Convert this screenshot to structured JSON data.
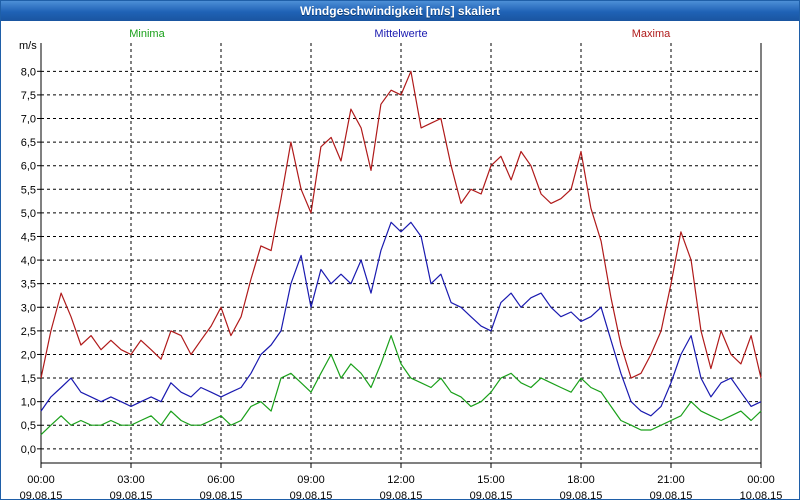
{
  "window": {
    "title": "Windgeschwindigkeit [m/s] skaliert"
  },
  "legend": [
    {
      "label": "Minima",
      "color": "#1aa01a"
    },
    {
      "label": "Mittelwerte",
      "color": "#1a1ab0"
    },
    {
      "label": "Maxima",
      "color": "#b01a1a"
    }
  ],
  "chart_data": {
    "type": "line",
    "ylabel": "m/s",
    "xlabel": "",
    "ylim": [
      -0.3,
      8.6
    ],
    "yticks": [
      "0,0",
      "0,5",
      "1,0",
      "1,5",
      "2,0",
      "2,5",
      "3,0",
      "3,5",
      "4,0",
      "4,5",
      "5,0",
      "5,5",
      "6,0",
      "6,5",
      "7,0",
      "7,5",
      "8,0"
    ],
    "xticks": [
      {
        "time": "00:00",
        "date": "09.08.15"
      },
      {
        "time": "03:00",
        "date": "09.08.15"
      },
      {
        "time": "06:00",
        "date": "09.08.15"
      },
      {
        "time": "09:00",
        "date": "09.08.15"
      },
      {
        "time": "12:00",
        "date": "09.08.15"
      },
      {
        "time": "15:00",
        "date": "09.08.15"
      },
      {
        "time": "18:00",
        "date": "09.08.15"
      },
      {
        "time": "21:00",
        "date": "09.08.15"
      },
      {
        "time": "00:00",
        "date": "10.08.15"
      }
    ],
    "grid": true,
    "x_hours": [
      0,
      0.33,
      0.67,
      1,
      1.33,
      1.67,
      2,
      2.33,
      2.67,
      3,
      3.33,
      3.67,
      4,
      4.33,
      4.67,
      5,
      5.33,
      5.67,
      6,
      6.33,
      6.67,
      7,
      7.33,
      7.67,
      8,
      8.33,
      8.67,
      9,
      9.33,
      9.67,
      10,
      10.33,
      10.67,
      11,
      11.33,
      11.67,
      12,
      12.33,
      12.67,
      13,
      13.33,
      13.67,
      14,
      14.33,
      14.67,
      15,
      15.33,
      15.67,
      16,
      16.33,
      16.67,
      17,
      17.33,
      17.67,
      18,
      18.33,
      18.67,
      19,
      19.33,
      19.67,
      20,
      20.33,
      20.67,
      21,
      21.33,
      21.67,
      22,
      22.33,
      22.67,
      23,
      23.33,
      23.67,
      24
    ],
    "series": [
      {
        "name": "Minima",
        "color": "#1aa01a",
        "values": [
          0.3,
          0.5,
          0.7,
          0.5,
          0.6,
          0.5,
          0.5,
          0.6,
          0.5,
          0.5,
          0.6,
          0.7,
          0.5,
          0.8,
          0.6,
          0.5,
          0.5,
          0.6,
          0.7,
          0.5,
          0.6,
          0.9,
          1.0,
          0.8,
          1.5,
          1.6,
          1.4,
          1.2,
          1.6,
          2.0,
          1.5,
          1.8,
          1.6,
          1.3,
          1.8,
          2.4,
          1.8,
          1.5,
          1.4,
          1.3,
          1.5,
          1.2,
          1.1,
          0.9,
          1.0,
          1.2,
          1.5,
          1.6,
          1.4,
          1.3,
          1.5,
          1.4,
          1.3,
          1.2,
          1.5,
          1.3,
          1.2,
          0.9,
          0.6,
          0.5,
          0.4,
          0.4,
          0.5,
          0.6,
          0.7,
          1.0,
          0.8,
          0.7,
          0.6,
          0.7,
          0.8,
          0.6,
          0.8
        ]
      },
      {
        "name": "Mittelwerte",
        "color": "#1a1ab0",
        "values": [
          0.8,
          1.1,
          1.3,
          1.5,
          1.2,
          1.1,
          1.0,
          1.1,
          1.0,
          0.9,
          1.0,
          1.1,
          1.0,
          1.4,
          1.2,
          1.1,
          1.3,
          1.2,
          1.1,
          1.2,
          1.3,
          1.6,
          2.0,
          2.2,
          2.5,
          3.5,
          4.1,
          3.0,
          3.8,
          3.5,
          3.7,
          3.5,
          4.0,
          3.3,
          4.2,
          4.8,
          4.6,
          4.8,
          4.5,
          3.5,
          3.7,
          3.1,
          3.0,
          2.8,
          2.6,
          2.5,
          3.1,
          3.3,
          3.0,
          3.2,
          3.3,
          3.0,
          2.8,
          2.9,
          2.7,
          2.8,
          3.0,
          2.3,
          1.6,
          1.0,
          0.8,
          0.7,
          0.9,
          1.4,
          2.0,
          2.4,
          1.5,
          1.1,
          1.4,
          1.5,
          1.2,
          0.9,
          1.0
        ]
      },
      {
        "name": "Maxima",
        "color": "#b01a1a",
        "values": [
          1.5,
          2.5,
          3.3,
          2.8,
          2.2,
          2.4,
          2.1,
          2.3,
          2.1,
          2.0,
          2.3,
          2.1,
          1.9,
          2.5,
          2.4,
          2.0,
          2.3,
          2.6,
          3.0,
          2.4,
          2.8,
          3.6,
          4.3,
          4.2,
          5.3,
          6.5,
          5.5,
          5.0,
          6.4,
          6.6,
          6.1,
          7.2,
          6.8,
          5.9,
          7.3,
          7.6,
          7.5,
          8.0,
          6.8,
          6.9,
          7.0,
          6.0,
          5.2,
          5.5,
          5.4,
          6.0,
          6.2,
          5.7,
          6.3,
          6.0,
          5.4,
          5.2,
          5.3,
          5.5,
          6.3,
          5.1,
          4.4,
          3.2,
          2.2,
          1.5,
          1.6,
          2.0,
          2.5,
          3.5,
          4.6,
          4.0,
          2.5,
          1.7,
          2.5,
          2.0,
          1.8,
          2.4,
          1.5
        ]
      }
    ]
  }
}
